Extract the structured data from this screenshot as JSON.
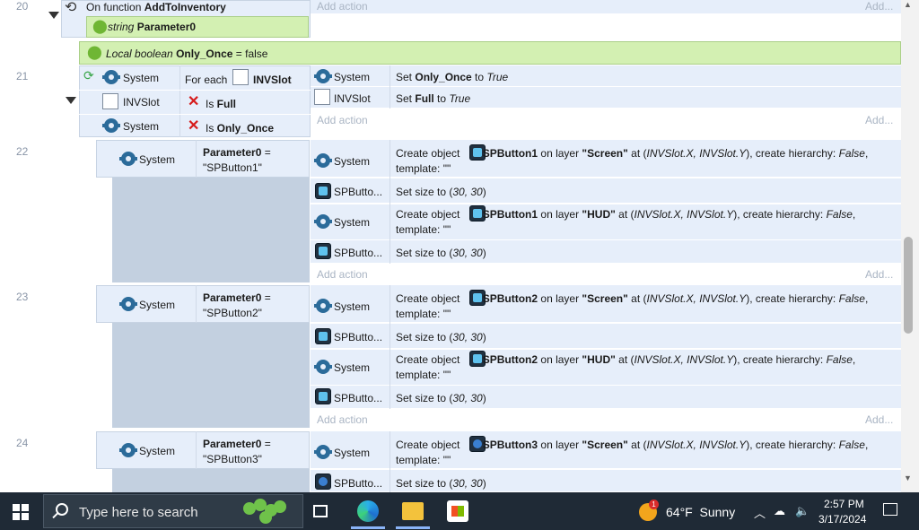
{
  "rows": {
    "r20": {
      "num": "20",
      "event_prefix": "On function ",
      "event_name": "AddToInventory",
      "param_type": "string",
      "param_name": "Parameter0",
      "add_action": "Add action",
      "add": "Add..."
    },
    "local": {
      "prefix": "Local boolean ",
      "name": "Only_Once",
      "suffix": " = false"
    },
    "r21": {
      "num": "21",
      "c1_obj": "System",
      "c1_text_pre": "For each ",
      "c1_text_obj": "INVSlot",
      "c2_obj": "INVSlot",
      "c2_text_pre": "Is ",
      "c2_text_b": "Full",
      "c3_obj": "System",
      "c3_text_pre": "Is ",
      "c3_text_b": "Only_Once",
      "a1_obj": "System",
      "a1_pre": "Set ",
      "a1_b": "Only_Once",
      "a1_mid": " to ",
      "a1_i": "True",
      "a2_obj": "INVSlot",
      "a2_pre": "Set ",
      "a2_b": "Full",
      "a2_mid": " to ",
      "a2_i": "True",
      "add_action": "Add action",
      "add": "Add..."
    },
    "r22": {
      "num": "22",
      "cond_obj": "System",
      "cond_param": "Parameter0",
      "cond_eq": " =",
      "cond_val": "\"SPButton1\"",
      "a1_obj": "System",
      "a1_pre": "Create object ",
      "a1_b": "SPButton1",
      "a1_layer_pre": " on layer ",
      "a1_layer": "\"Screen\"",
      "a1_at": " at (",
      "a1_xy": "INVSlot.X, INVSlot.Y",
      "a1_ch": "), create hierarchy: ",
      "a1_false": "False",
      "a1_tpl": ",",
      "a1_tpl2": "template: \"\"",
      "a2_obj": "SPButto...",
      "a2_text": "Set size to (",
      "a2_val": "30, 30",
      "a2_close": ")",
      "a3_obj": "System",
      "a3_pre": "Create object ",
      "a3_b": "SPButton1",
      "a3_layer_pre": " on layer ",
      "a3_layer": "\"HUD\"",
      "a3_at": " at (",
      "a3_xy": "INVSlot.X, INVSlot.Y",
      "a3_ch": "), create hierarchy: ",
      "a3_false": "False",
      "a3_tpl": ",",
      "a3_tpl2": "template: \"\"",
      "a4_obj": "SPButto...",
      "a4_text": "Set size to (",
      "a4_val": "30, 30",
      "a4_close": ")",
      "add_action": "Add action",
      "add": "Add..."
    },
    "r23": {
      "num": "23",
      "cond_obj": "System",
      "cond_param": "Parameter0",
      "cond_eq": " =",
      "cond_val": "\"SPButton2\"",
      "a1_obj": "System",
      "a1_pre": "Create object ",
      "a1_b": "SPButton2",
      "a1_layer_pre": " on layer ",
      "a1_layer": "\"Screen\"",
      "a1_at": " at (",
      "a1_xy": "INVSlot.X, INVSlot.Y",
      "a1_ch": "), create hierarchy: ",
      "a1_false": "False",
      "a1_tpl": ",",
      "a1_tpl2": "template: \"\"",
      "a2_obj": "SPButto...",
      "a2_text": "Set size to (",
      "a2_val": "30, 30",
      "a2_close": ")",
      "a3_obj": "System",
      "a3_pre": "Create object ",
      "a3_b": "SPButton2",
      "a3_layer_pre": " on layer ",
      "a3_layer": "\"HUD\"",
      "a3_at": " at (",
      "a3_xy": "INVSlot.X, INVSlot.Y",
      "a3_ch": "), create hierarchy: ",
      "a3_false": "False",
      "a3_tpl": ",",
      "a3_tpl2": "template: \"\"",
      "a4_obj": "SPButto...",
      "a4_text": "Set size to (",
      "a4_val": "30, 30",
      "a4_close": ")",
      "add_action": "Add action",
      "add": "Add..."
    },
    "r24": {
      "num": "24",
      "cond_obj": "System",
      "cond_param": "Parameter0",
      "cond_eq": " =",
      "cond_val": "\"SPButton3\"",
      "a1_obj": "System",
      "a1_pre": "Create object ",
      "a1_b": "SPButton3",
      "a1_layer_pre": " on layer ",
      "a1_layer": "\"Screen\"",
      "a1_at": " at (",
      "a1_xy": "INVSlot.X, INVSlot.Y",
      "a1_ch": "), create hierarchy: ",
      "a1_false": "False",
      "a1_tpl": ",",
      "a1_tpl2": "template: \"\"",
      "a2_obj": "SPButto...",
      "a2_text": "Set size to (",
      "a2_val": "30, 30",
      "a2_close": ")"
    }
  },
  "taskbar": {
    "search_placeholder": "Type here to search",
    "weather_temp": "64°F",
    "weather_cond": "Sunny",
    "weather_badge": "1",
    "time": "2:57 PM",
    "date": "3/17/2024"
  },
  "icons": {
    "start": "windows-start-icon",
    "search": "search-icon",
    "edge": "edge-browser-icon",
    "explorer": "file-explorer-icon",
    "store": "microsoft-store-icon",
    "gear": "system-gear-icon"
  },
  "colors": {
    "condition_bg": "#e6eefa",
    "green_row": "#d3f0b2",
    "empty_block": "#c3d0e0",
    "taskbar": "#1f2a36",
    "red_x": "#d61b1b",
    "gear": "#2b6b9a"
  }
}
